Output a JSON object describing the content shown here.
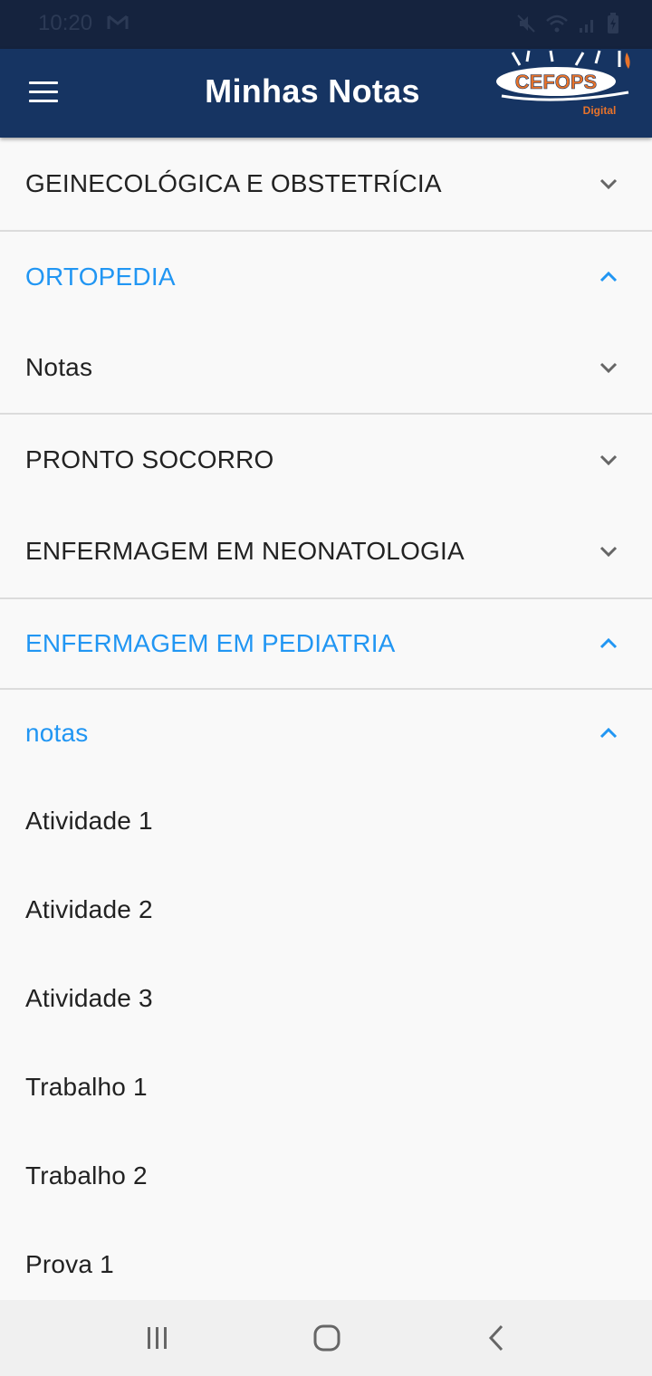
{
  "status_bar": {
    "time": "10:20",
    "icons": [
      "gmail-icon",
      "mute-icon",
      "wifi-icon",
      "signal-icon",
      "battery-charging-icon"
    ]
  },
  "app_bar": {
    "title": "Minhas Notas",
    "logo_text": "CEFOPS",
    "logo_subtext": "Digital",
    "colors": {
      "background": "#163462",
      "logo_accent": "#e8732a"
    }
  },
  "accent_color": "#2196f3",
  "sections": [
    {
      "label": "GEINECOLÓGICA E OBSTETRÍCIA",
      "expanded": false
    },
    {
      "label": "ORTOPEDIA",
      "expanded": true
    },
    {
      "label": "Notas",
      "expanded": false
    },
    {
      "label": "PRONTO SOCORRO",
      "expanded": false
    },
    {
      "label": "ENFERMAGEM EM NEONATOLOGIA",
      "expanded": false
    },
    {
      "label": "ENFERMAGEM EM PEDIATRIA",
      "expanded": true
    },
    {
      "label": "notas",
      "expanded": true
    }
  ],
  "grade_items": [
    {
      "label": "Atividade 1"
    },
    {
      "label": "Atividade 2"
    },
    {
      "label": "Atividade 3"
    },
    {
      "label": "Trabalho 1"
    },
    {
      "label": "Trabalho 2"
    },
    {
      "label": "Prova 1"
    }
  ],
  "nav_bar": {
    "buttons": [
      "recent-apps-icon",
      "home-icon",
      "back-icon"
    ]
  }
}
